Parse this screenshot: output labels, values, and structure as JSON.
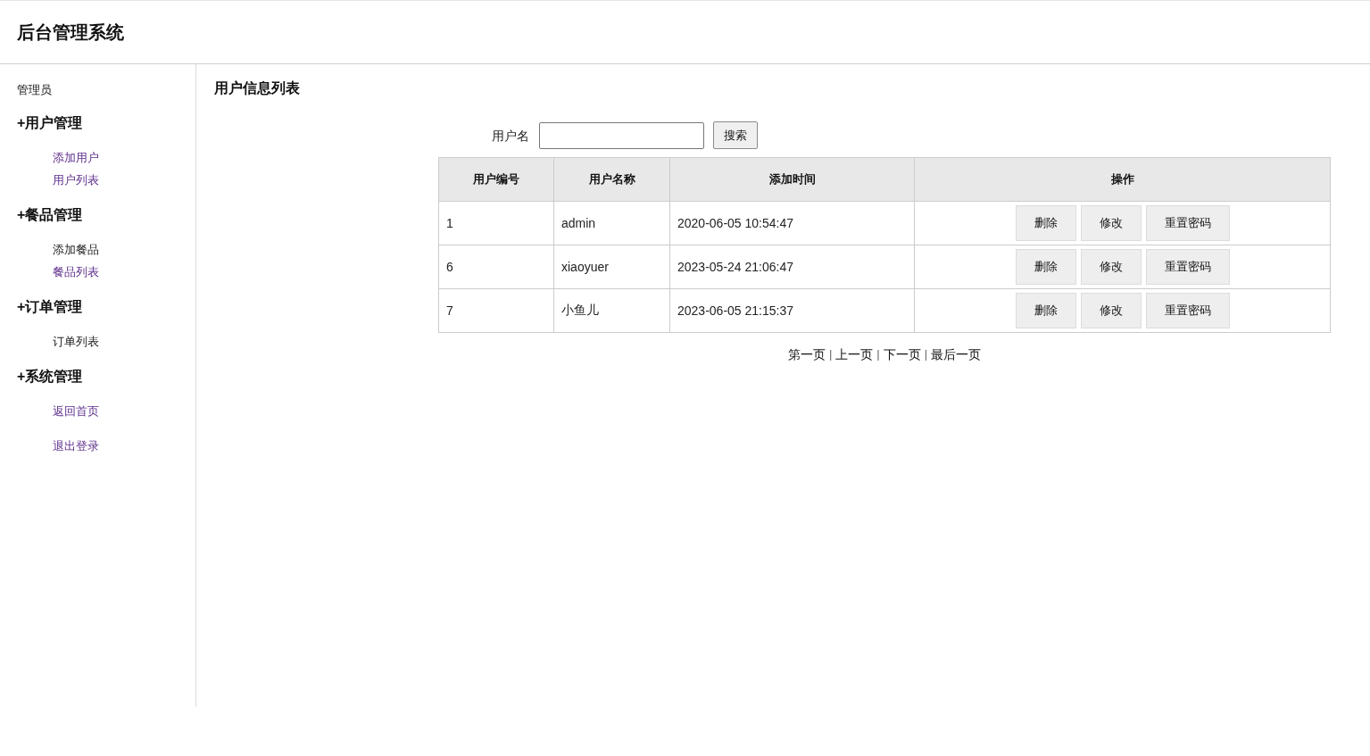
{
  "header": {
    "title": "后台管理系统"
  },
  "sidebar": {
    "role": "管理员",
    "sections": [
      {
        "title": "+用户管理",
        "links": [
          {
            "label": "添加用户",
            "visited": true
          },
          {
            "label": "用户列表",
            "visited": true
          }
        ]
      },
      {
        "title": "+餐品管理",
        "links": [
          {
            "label": "添加餐品",
            "visited": false
          },
          {
            "label": "餐品列表",
            "visited": true
          }
        ]
      },
      {
        "title": "+订单管理",
        "links": [
          {
            "label": "订单列表",
            "visited": false
          }
        ]
      },
      {
        "title": "+系统管理",
        "links": [
          {
            "label": "返回首页",
            "visited": true
          },
          {
            "label": "退出登录",
            "visited": true
          }
        ]
      }
    ]
  },
  "main": {
    "title": "用户信息列表",
    "search": {
      "label": "用户名",
      "button": "搜索"
    },
    "table": {
      "columns": [
        "用户编号",
        "用户名称",
        "添加时间",
        "操作"
      ],
      "rows": [
        {
          "cells": [
            "1",
            "admin",
            "2020-06-05 10:54:47"
          ],
          "actions": [
            "删除",
            "修改",
            "重置密码"
          ]
        },
        {
          "cells": [
            "6",
            "xiaoyuer",
            "2023-05-24 21:06:47"
          ],
          "actions": [
            "删除",
            "修改",
            "重置密码"
          ]
        },
        {
          "cells": [
            "7",
            "小鱼儿",
            "2023-06-05 21:15:37"
          ],
          "actions": [
            "删除",
            "修改",
            "重置密码"
          ]
        }
      ]
    },
    "pagination": [
      {
        "kind": "link",
        "text": "第一页"
      },
      {
        "kind": "separator",
        "text": "|"
      },
      {
        "kind": "link",
        "text": "上一页"
      },
      {
        "kind": "separator",
        "text": "|"
      },
      {
        "kind": "link",
        "text": "下一页"
      },
      {
        "kind": "separator",
        "text": "|"
      },
      {
        "kind": "link",
        "text": "最后一页"
      }
    ]
  }
}
